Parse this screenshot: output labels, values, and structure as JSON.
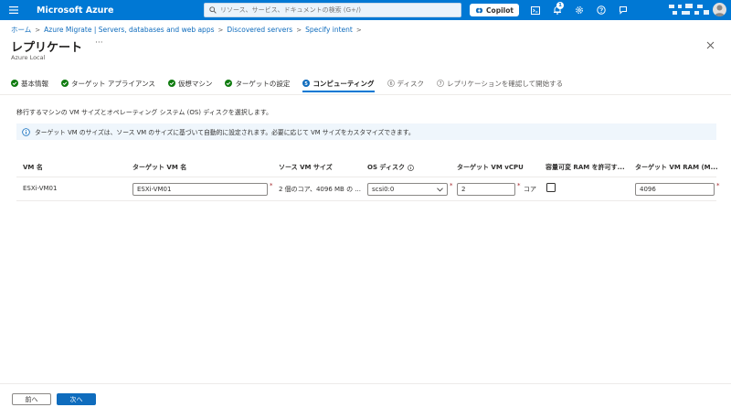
{
  "topbar": {
    "brand": "Microsoft Azure",
    "search_placeholder": "リソース、サービス、ドキュメントの検索 (G+/)",
    "copilot_label": "Copilot",
    "notification_count": "1",
    "colors": {
      "bar": "#0078d4"
    }
  },
  "breadcrumb": [
    "ホーム",
    "Azure Migrate | Servers, databases and web apps",
    "Discovered servers",
    "Specify intent"
  ],
  "page": {
    "title": "レプリケート",
    "more": "···",
    "subtitle": "Azure Local"
  },
  "steps": [
    {
      "label": "基本情報",
      "state": "done"
    },
    {
      "label": "ターゲット アプライアンス",
      "state": "done"
    },
    {
      "label": "仮想マシン",
      "state": "done"
    },
    {
      "label": "ターゲットの設定",
      "state": "done"
    },
    {
      "label": "コンピューティング",
      "state": "active",
      "number": "5"
    },
    {
      "label": "ディスク",
      "state": "pending",
      "number": "6"
    },
    {
      "label": "レプリケーションを確認して開始する",
      "state": "pending",
      "number": "7"
    }
  ],
  "description": "移行するマシンの VM サイズとオペレーティング システム (OS) ディスクを選択します。",
  "info_text": "ターゲット VM のサイズは、ソース VM のサイズに基づいて自動的に設定されます。必要に応じて VM サイズをカスタマイズできます。",
  "table": {
    "headers": [
      "VM 名",
      "ターゲット VM 名",
      "ソース VM サイズ",
      "OS ディスク",
      "ターゲット VM vCPU",
      "容量可変 RAM を許可す...",
      "ターゲット VM RAM (M..."
    ],
    "rows": [
      {
        "vm_name": "ESXi-VM01",
        "target_vm_name": "ESXi-VM01",
        "source_size": "2 個のコア、4096 MB の ...",
        "os_disk": "scsi0:0",
        "vcpu": "2",
        "vcpu_unit": "コア",
        "dynamic_ram": false,
        "ram": "4096"
      }
    ],
    "required_mark": "*"
  },
  "footer": {
    "prev_label": "前へ",
    "next_label": "次へ"
  }
}
